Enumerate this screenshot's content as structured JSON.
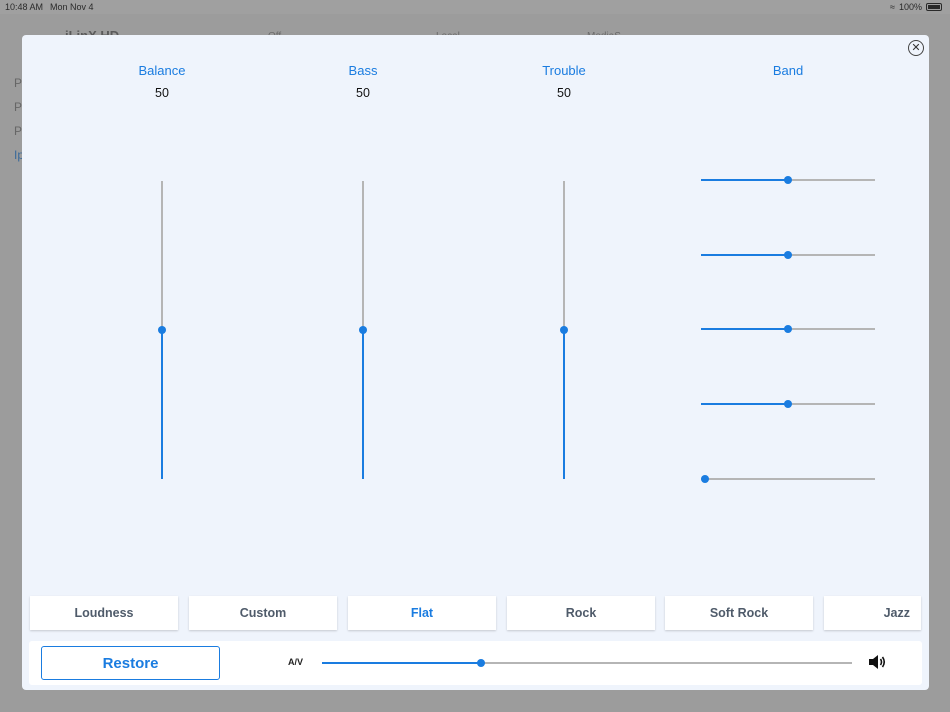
{
  "status_bar": {
    "time": "10:48 AM",
    "date": "Mon Nov 4",
    "battery": "100%"
  },
  "background_app": {
    "title": "iLinX HD",
    "tabs": [
      "Off",
      "Local",
      "MediaS"
    ],
    "sidebar_items": [
      "P",
      "P",
      "P",
      "Ip"
    ]
  },
  "modal": {
    "close_icon": "close-icon",
    "columns": [
      {
        "label": "Balance",
        "value": "50",
        "level": 0.5
      },
      {
        "label": "Bass",
        "value": "50",
        "level": 0.5
      },
      {
        "label": "Trouble",
        "value": "50",
        "level": 0.5
      }
    ],
    "band": {
      "label": "Band",
      "sliders": [
        {
          "level": 0.5
        },
        {
          "level": 0.5
        },
        {
          "level": 0.5
        },
        {
          "level": 0.5
        },
        {
          "level": 0.0
        }
      ]
    },
    "presets": [
      "Loudness",
      "Custom",
      "Flat",
      "Rock",
      "Soft Rock",
      "Jazz"
    ],
    "active_preset": "Flat",
    "restore_label": "Restore",
    "av_label": "A/V",
    "av_level": 0.3,
    "speaker_icon": "speaker-icon"
  },
  "colors": {
    "accent": "#1a7ce0",
    "track": "#b5b5b5",
    "modal_bg": "#eff4fc",
    "preset_text": "#4f5b6a"
  }
}
